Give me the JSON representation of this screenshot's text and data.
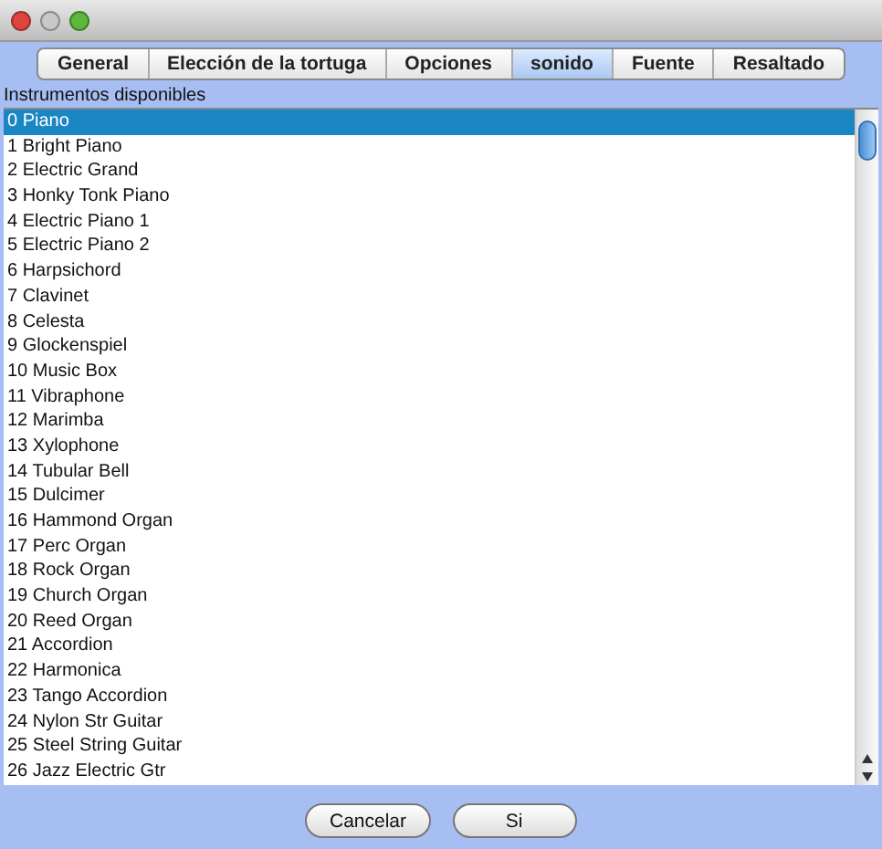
{
  "tabs": [
    {
      "label": "General",
      "selected": false
    },
    {
      "label": "Elección de la tortuga",
      "selected": false
    },
    {
      "label": "Opciones",
      "selected": false
    },
    {
      "label": "sonido",
      "selected": true
    },
    {
      "label": "Fuente",
      "selected": false
    },
    {
      "label": "Resaltado",
      "selected": false
    }
  ],
  "list": {
    "label": "Instrumentos disponibles",
    "items": [
      {
        "text": "0 Piano",
        "selected": true
      },
      {
        "text": "1 Bright Piano",
        "selected": false
      },
      {
        "text": "2 Electric Grand",
        "selected": false
      },
      {
        "text": "3 Honky Tonk Piano",
        "selected": false
      },
      {
        "text": "4 Electric Piano 1",
        "selected": false
      },
      {
        "text": "5 Electric Piano 2",
        "selected": false
      },
      {
        "text": "6 Harpsichord",
        "selected": false
      },
      {
        "text": "7 Clavinet",
        "selected": false
      },
      {
        "text": "8 Celesta",
        "selected": false
      },
      {
        "text": "9 Glockenspiel",
        "selected": false
      },
      {
        "text": "10 Music Box",
        "selected": false
      },
      {
        "text": "11 Vibraphone",
        "selected": false
      },
      {
        "text": "12 Marimba",
        "selected": false
      },
      {
        "text": "13 Xylophone",
        "selected": false
      },
      {
        "text": "14 Tubular Bell",
        "selected": false
      },
      {
        "text": "15 Dulcimer",
        "selected": false
      },
      {
        "text": "16 Hammond Organ",
        "selected": false
      },
      {
        "text": "17 Perc Organ",
        "selected": false
      },
      {
        "text": "18 Rock Organ",
        "selected": false
      },
      {
        "text": "19 Church Organ",
        "selected": false
      },
      {
        "text": "20 Reed Organ",
        "selected": false
      },
      {
        "text": "21 Accordion",
        "selected": false
      },
      {
        "text": "22 Harmonica",
        "selected": false
      },
      {
        "text": "23 Tango Accordion",
        "selected": false
      },
      {
        "text": "24 Nylon Str Guitar",
        "selected": false
      },
      {
        "text": "25 Steel String Guitar",
        "selected": false
      },
      {
        "text": "26 Jazz Electric Gtr",
        "selected": false
      }
    ]
  },
  "buttons": [
    "Cancelar",
    "Si"
  ]
}
